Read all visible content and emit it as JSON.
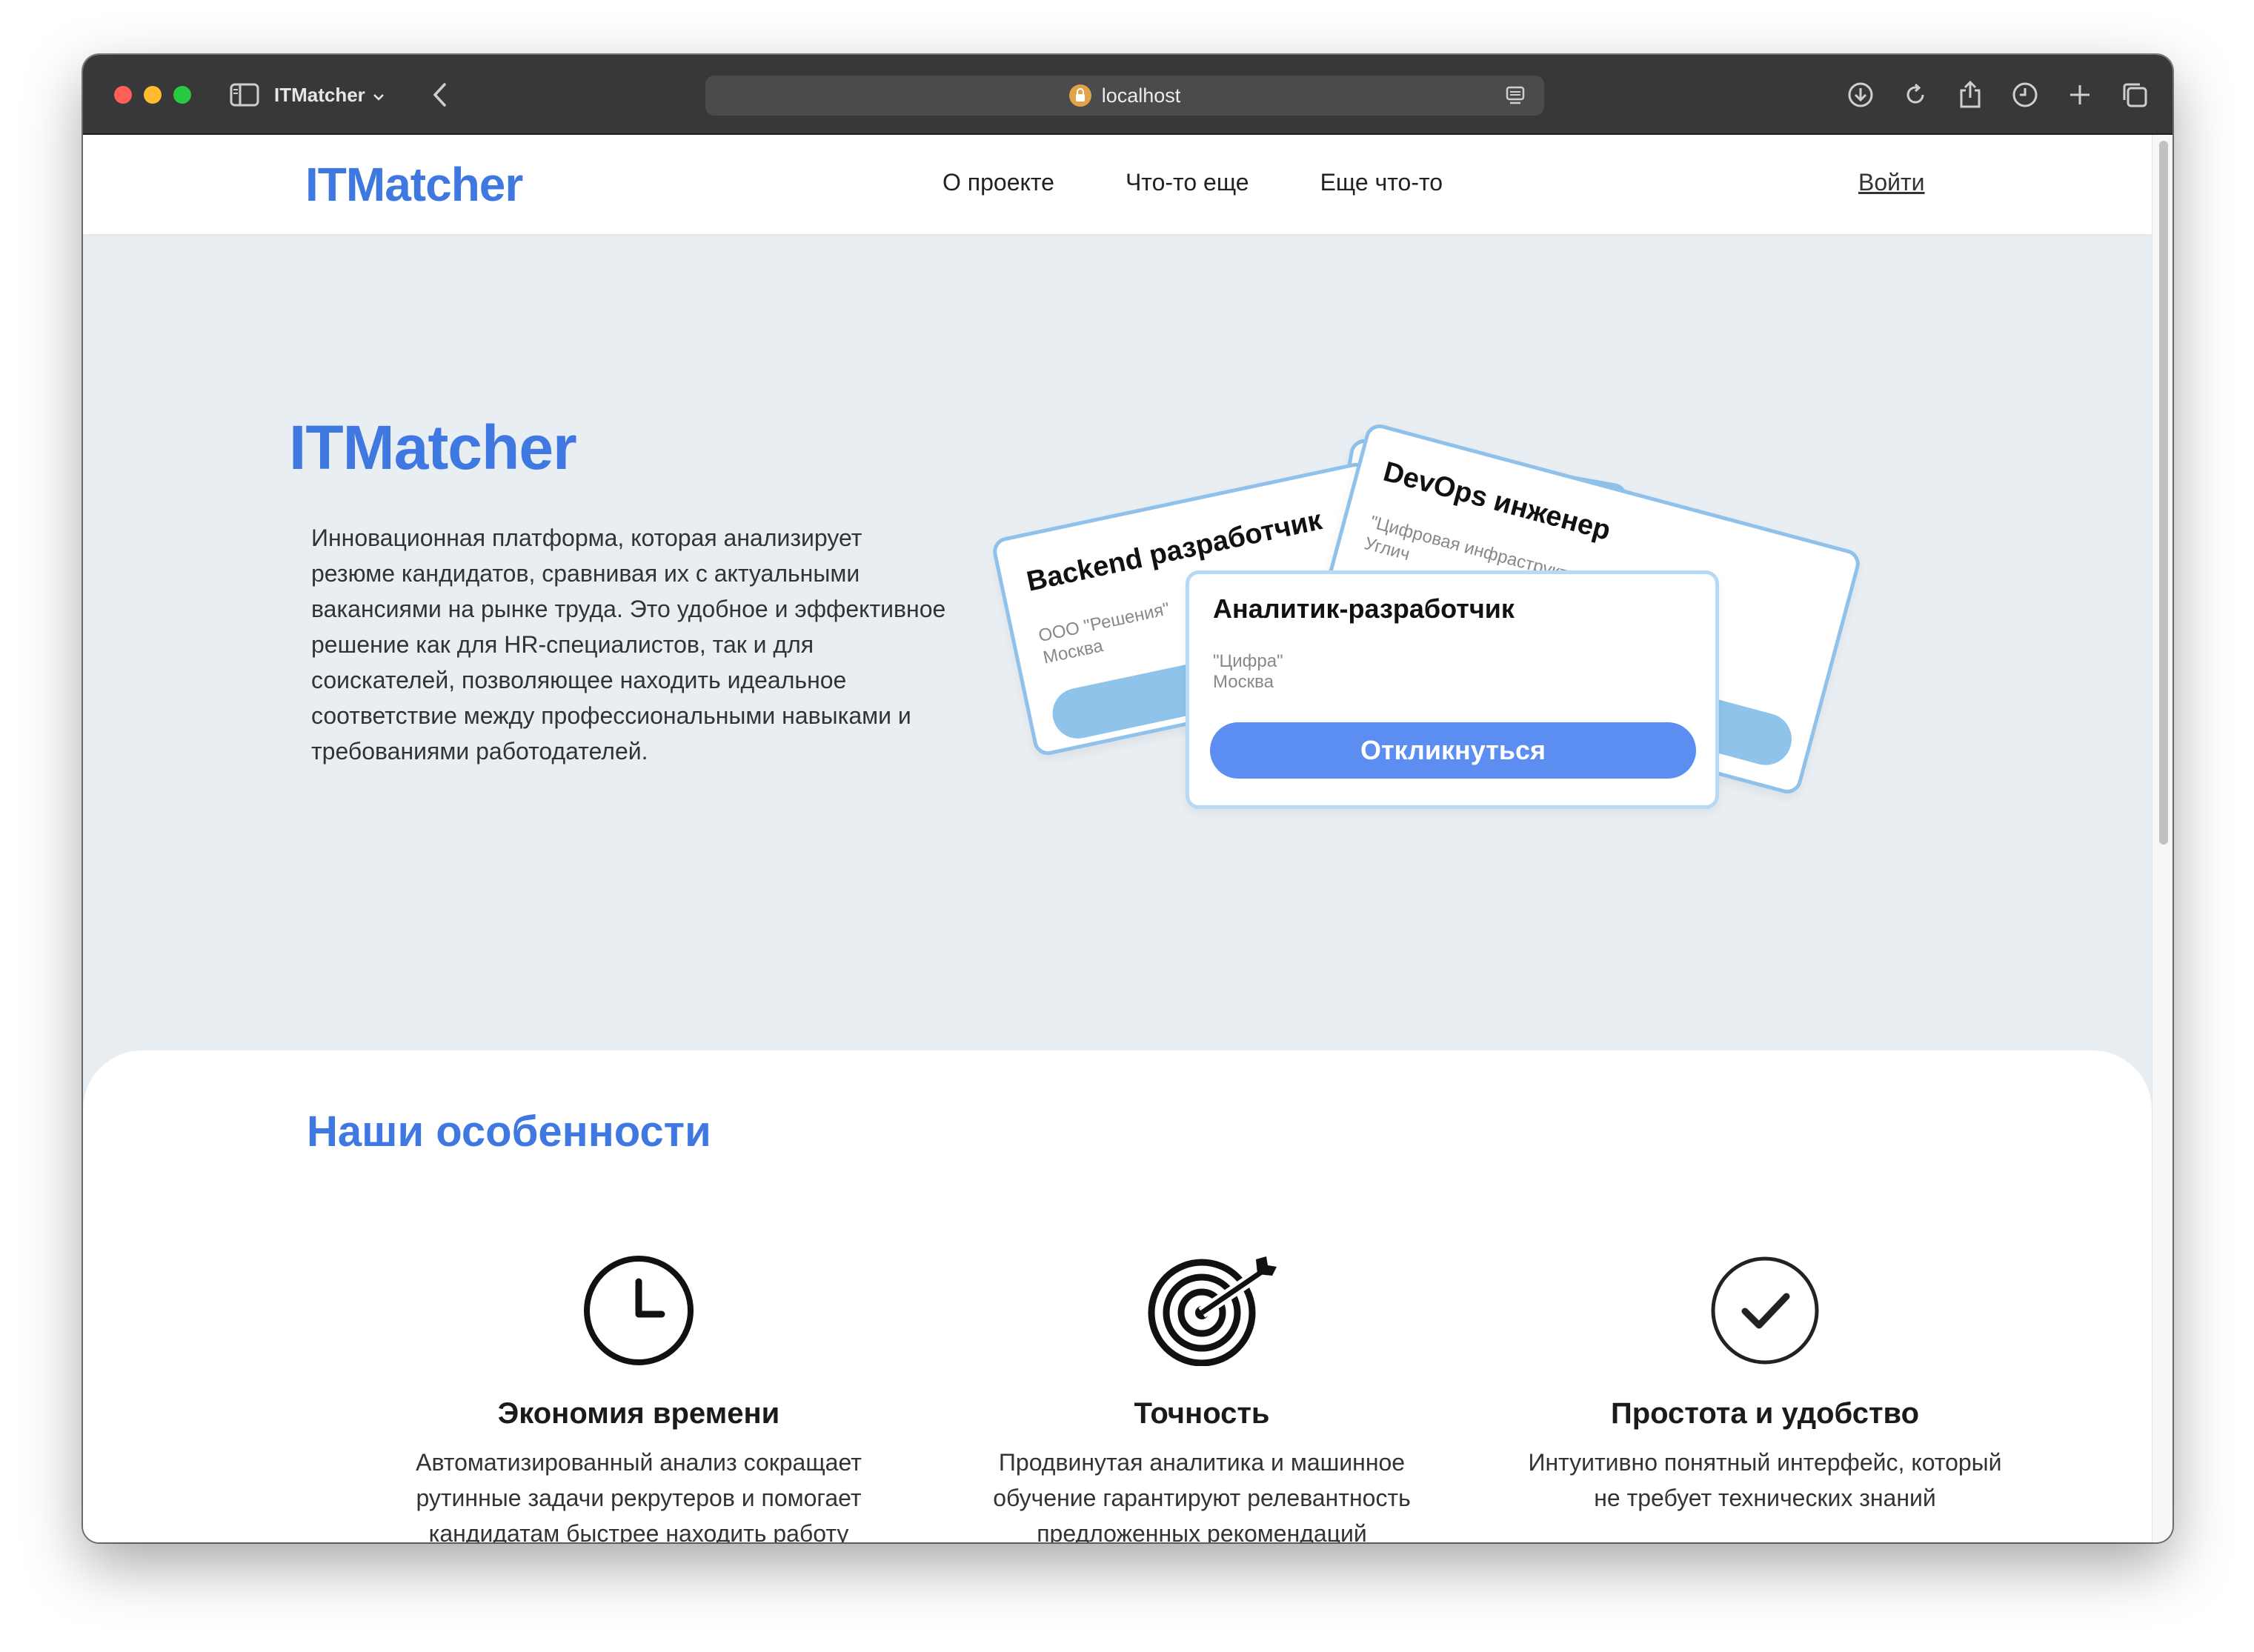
{
  "browser": {
    "tab_title": "ITMatcher",
    "url": "localhost"
  },
  "header": {
    "logo": "ITMatcher",
    "nav": [
      "О проекте",
      "Что-то еще",
      "Еще что-то"
    ],
    "login": "Войти"
  },
  "hero": {
    "title": "ITMatcher",
    "description": "Инновационная платформа, которая анализирует резюме кандидатов, сравнивая их с актуальными вакансиями на рынке труда. Это удобное и эффективное решение как для HR-специалистов, так и для соискателей, позволяющее находить идеальное соответствие между профессиональными навыками и требованиями работодателей."
  },
  "cards": {
    "backend": {
      "title": "Backend разработчик",
      "company": "ООО \"Решения\"",
      "city": "Москва"
    },
    "devops": {
      "title": "DevOps инженер",
      "company": "\"Цифровая инфраструктура\"",
      "city": "Углич"
    },
    "analyst": {
      "title": "Аналитик-разработчик",
      "company": "\"Цифра\"",
      "city": "Москва",
      "button": "Откликнуться"
    }
  },
  "features": {
    "title": "Наши особенности",
    "items": [
      {
        "icon": "clock-icon",
        "title": "Экономия времени",
        "description": "Автоматизированный анализ сокращает рутинные задачи рекрутеров и помогает кандидатам быстрее находить работу"
      },
      {
        "icon": "target-icon",
        "title": "Точность",
        "description": "Продвинутая аналитика и машинное обучение гарантируют релевантность предложенных рекомендаций"
      },
      {
        "icon": "checkmark-icon",
        "title": "Простота и удобство",
        "description": "Интуитивно понятный интерфейс, который не требует технических знаний"
      }
    ]
  },
  "colors": {
    "brand": "#3f78e0",
    "button": "#5b8ef0",
    "card_border": "#8fc1ea",
    "hero_bg": "#e8eef2"
  }
}
